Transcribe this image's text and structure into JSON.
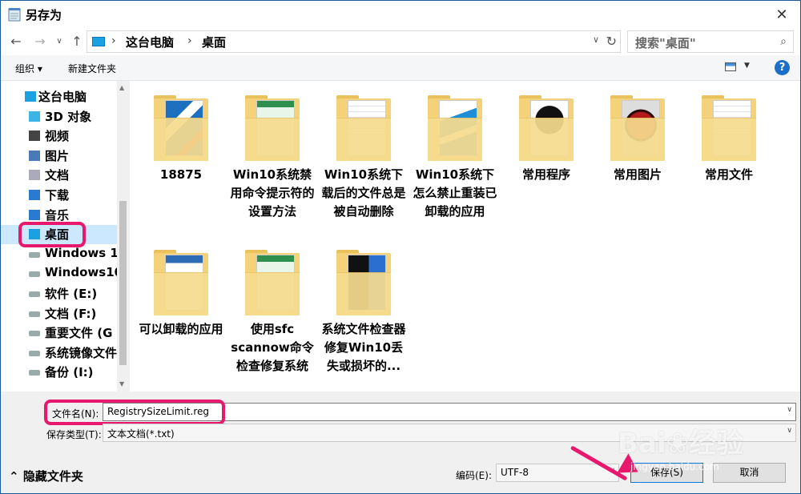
{
  "window": {
    "title": "另存为"
  },
  "address": {
    "crumbs": [
      "这台电脑",
      "桌面"
    ],
    "search_placeholder": "搜索\"桌面\""
  },
  "toolbar": {
    "organize": "组织 ▾",
    "new_folder": "新建文件夹",
    "help": "?"
  },
  "nav": {
    "items": [
      {
        "label": "这台电脑",
        "icon": "pc-icon"
      },
      {
        "label": "3D 对象",
        "icon": "3d-objects-icon"
      },
      {
        "label": "视频",
        "icon": "video-icon"
      },
      {
        "label": "图片",
        "icon": "pictures-icon"
      },
      {
        "label": "文档",
        "icon": "documents-icon"
      },
      {
        "label": "下载",
        "icon": "download-icon"
      },
      {
        "label": "音乐",
        "icon": "music-icon"
      },
      {
        "label": "桌面",
        "icon": "desktop-icon"
      },
      {
        "label": "Windows 1",
        "icon": "drive-icon"
      },
      {
        "label": "Windows10",
        "icon": "drive-icon"
      },
      {
        "label": "软件 (E:)",
        "icon": "drive-icon"
      },
      {
        "label": "文档 (F:)",
        "icon": "drive-icon"
      },
      {
        "label": "重要文件 (G",
        "icon": "drive-icon"
      },
      {
        "label": "系统镜像文件",
        "icon": "drive-icon"
      },
      {
        "label": "备份 (I:)",
        "icon": "drive-icon"
      }
    ]
  },
  "folders": [
    {
      "label": "18875",
      "thumb": "blue-screenshot"
    },
    {
      "label": "Win10系统禁用命令提示符的设置方法",
      "thumb": "green-doc"
    },
    {
      "label": "Win10系统下载后的文件总是被自动删除",
      "thumb": "white-doc"
    },
    {
      "label": "Win10系统下怎么禁止重装已卸载的应用",
      "thumb": "blue-shapes"
    },
    {
      "label": "常用程序",
      "thumb": "qq-penguin"
    },
    {
      "label": "常用图片",
      "thumb": "red-dragon"
    },
    {
      "label": "常用文件",
      "thumb": "white-doc"
    },
    {
      "label": "可以卸载的应用",
      "thumb": "settings-window"
    },
    {
      "label": "使用sfc scannow命令检查修复系统",
      "thumb": "green-doc"
    },
    {
      "label": "系统文件检查器修复Win10丢失或损坏的...",
      "thumb": "dark-window"
    }
  ],
  "bottom": {
    "filename_label": "文件名(N):",
    "filename_value": "RegistrySizeLimit.reg",
    "type_label": "保存类型(T):",
    "type_value": "文本文档(*.txt)",
    "encoding_label": "编码(E):",
    "encoding_value": "UTF-8",
    "save": "保存(S)",
    "cancel": "取消",
    "collapse": "隐藏文件夹"
  },
  "watermark": {
    "brand": "Bai❀经验",
    "url": "jingyan.baidu.com"
  },
  "colors": {
    "highlight": "#e8186c",
    "selection": "#cce8ff",
    "accent": "#0078d7"
  }
}
